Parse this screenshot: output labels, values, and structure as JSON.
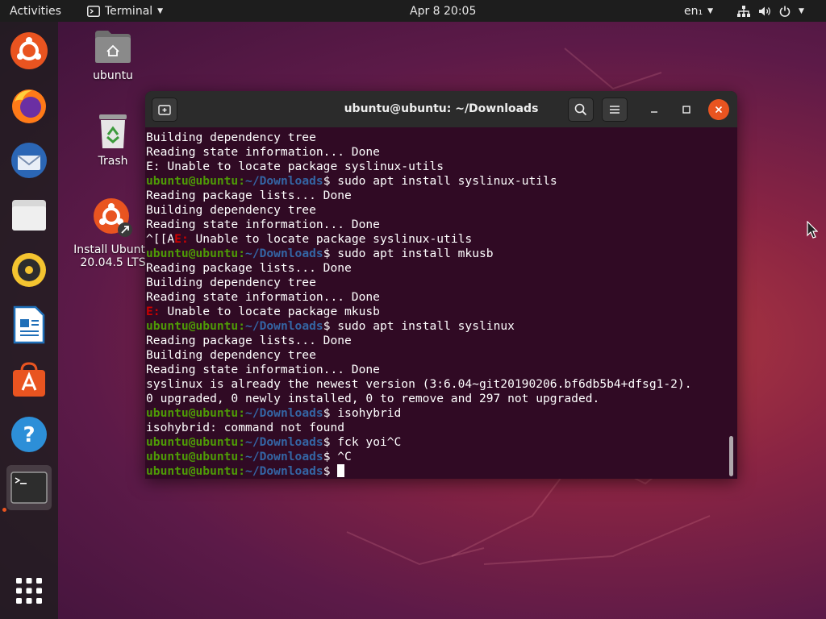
{
  "topbar": {
    "activities": "Activities",
    "app_name": "Terminal",
    "clock": "Apr 8  20:05",
    "language": "en₁"
  },
  "desktop": {
    "icons": [
      {
        "label": "ubuntu"
      },
      {
        "label": "Trash"
      },
      {
        "label": "Install Ubuntu 20.04.5 LTS"
      }
    ]
  },
  "dock": {
    "items": [
      {
        "name": "Ubuntu Software Installer"
      },
      {
        "name": "Firefox"
      },
      {
        "name": "Thunderbird"
      },
      {
        "name": "Files"
      },
      {
        "name": "Rhythmbox"
      },
      {
        "name": "LibreOffice Writer"
      },
      {
        "name": "Ubuntu Software"
      },
      {
        "name": "Help"
      },
      {
        "name": "Terminal"
      },
      {
        "name": "Show Applications"
      }
    ]
  },
  "terminal": {
    "title": "ubuntu@ubuntu: ~/Downloads",
    "prompt_user": "ubuntu@ubuntu",
    "prompt_path": "~/Downloads",
    "lines": [
      {
        "type": "text",
        "text": "Building dependency tree"
      },
      {
        "type": "text",
        "text": "Reading state information... Done"
      },
      {
        "type": "text",
        "text": "E: Unable to locate package syslinux-utils"
      },
      {
        "type": "prompt",
        "cmd": " sudo apt install syslinux-utils"
      },
      {
        "type": "text",
        "text": "Reading package lists... Done"
      },
      {
        "type": "text",
        "text": "Building dependency tree"
      },
      {
        "type": "text",
        "text": "Reading state information... Done"
      },
      {
        "type": "error",
        "pre": "^[[A",
        "err": "E:",
        "text": " Unable to locate package syslinux-utils"
      },
      {
        "type": "prompt",
        "cmd": " sudo apt install mkusb"
      },
      {
        "type": "text",
        "text": "Reading package lists... Done"
      },
      {
        "type": "text",
        "text": "Building dependency tree"
      },
      {
        "type": "text",
        "text": "Reading state information... Done"
      },
      {
        "type": "error",
        "pre": "",
        "err": "E:",
        "text": " Unable to locate package mkusb"
      },
      {
        "type": "prompt",
        "cmd": " sudo apt install syslinux"
      },
      {
        "type": "text",
        "text": "Reading package lists... Done"
      },
      {
        "type": "text",
        "text": "Building dependency tree"
      },
      {
        "type": "text",
        "text": "Reading state information... Done"
      },
      {
        "type": "text",
        "text": "syslinux is already the newest version (3:6.04~git20190206.bf6db5b4+dfsg1-2)."
      },
      {
        "type": "text",
        "text": "0 upgraded, 0 newly installed, 0 to remove and 297 not upgraded."
      },
      {
        "type": "prompt",
        "cmd": " isohybrid"
      },
      {
        "type": "text",
        "text": "isohybrid: command not found"
      },
      {
        "type": "prompt",
        "cmd": " fck yoi^C"
      },
      {
        "type": "prompt",
        "cmd": " ^C"
      },
      {
        "type": "prompt",
        "cmd": " ",
        "cursor": true
      }
    ]
  },
  "colors": {
    "terminal_bg": "#300a24",
    "prompt_user": "#4e9a06",
    "prompt_path": "#3465a4",
    "error": "#cc0000",
    "accent": "#e95420"
  }
}
